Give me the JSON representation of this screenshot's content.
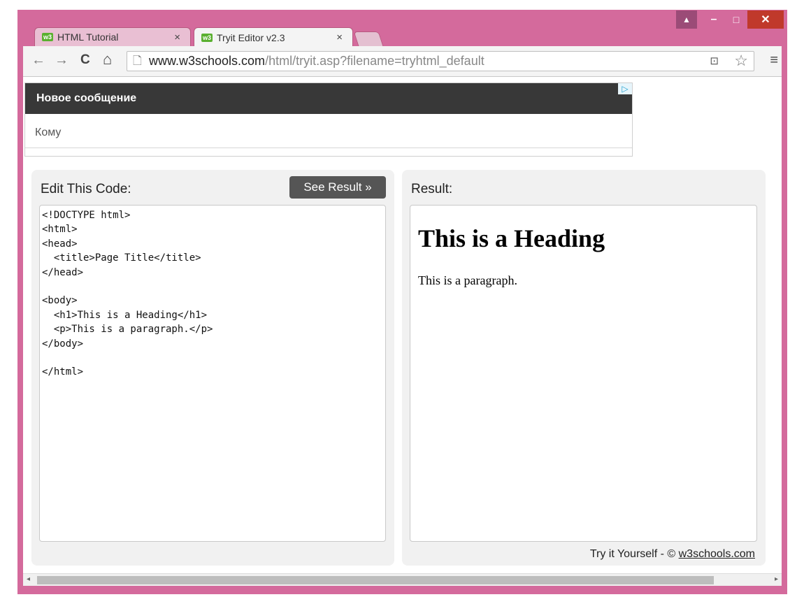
{
  "window": {
    "controls": {
      "user": "▲",
      "minimize": "–",
      "maximize": "□",
      "close": "✕"
    }
  },
  "tabs": [
    {
      "label": "HTML Tutorial",
      "icon": "w3",
      "close": "×"
    },
    {
      "label": "Tryit Editor v2.3",
      "icon": "w3",
      "close": "×"
    }
  ],
  "toolbar": {
    "back": "←",
    "forward": "→",
    "reload": "C",
    "home": "⌂",
    "url_host": "www.w3schools.com",
    "url_rest": "/html/tryit.asp?filename=tryhtml_default",
    "translate": "⊡",
    "star": "☆",
    "menu": "≡"
  },
  "ad": {
    "header": "Новое сообщение",
    "to_label": "Кому",
    "choices": "▷"
  },
  "editor": {
    "title": "Edit This Code:",
    "see_result": "See Result »",
    "code": "<!DOCTYPE html>\n<html>\n<head>\n  <title>Page Title</title>\n</head>\n\n<body>\n  <h1>This is a Heading</h1>\n  <p>This is a paragraph.</p>\n</body>\n\n</html>"
  },
  "result": {
    "title": "Result:",
    "heading": "This is a Heading",
    "paragraph": "This is a paragraph.",
    "footer_prefix": "Try it Yourself - © ",
    "footer_link": "w3schools.com"
  },
  "scrollbar": {
    "left": "◂",
    "right": "▸"
  }
}
